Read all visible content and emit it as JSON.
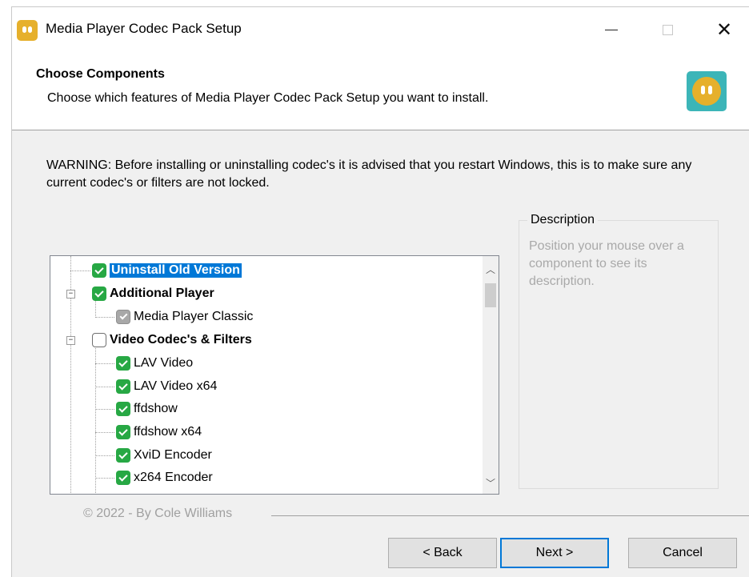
{
  "window": {
    "title": "Media Player Codec Pack Setup"
  },
  "header": {
    "title": "Choose Components",
    "subtitle": "Choose which features of Media Player Codec Pack Setup you want to install."
  },
  "warning": "WARNING: Before installing or uninstalling codec's it is advised that you restart Windows, this is to make sure any current codec's or filters are not locked.",
  "description": {
    "legend": "Description",
    "text": "Position your mouse over a component to see its description."
  },
  "tree": {
    "items": [
      {
        "label": "Uninstall Old Version",
        "state": "checked",
        "bold": true,
        "selected": true
      },
      {
        "label": "Additional Player",
        "state": "checked",
        "bold": true
      },
      {
        "label": "Media Player Classic",
        "state": "partial"
      },
      {
        "label": "Video Codec's & Filters",
        "state": "empty",
        "bold": true
      },
      {
        "label": "LAV Video",
        "state": "checked"
      },
      {
        "label": "LAV Video x64",
        "state": "checked"
      },
      {
        "label": "ffdshow",
        "state": "checked"
      },
      {
        "label": "ffdshow x64",
        "state": "checked"
      },
      {
        "label": "XviD Encoder",
        "state": "checked"
      },
      {
        "label": "x264 Encoder",
        "state": "checked"
      }
    ],
    "expanders": [
      "⊟",
      "⊟"
    ]
  },
  "footer": {
    "copyright": "© 2022 - By Cole Williams"
  },
  "buttons": {
    "back": "< Back",
    "next": "Next >",
    "cancel": "Cancel"
  },
  "icons": {
    "app": "app-logo-icon",
    "minimize": "minimize-icon",
    "maximize": "maximize-icon",
    "close": "close-icon",
    "scroll_up": "chevron-up-icon",
    "scroll_down": "chevron-down-icon"
  },
  "colors": {
    "accent": "#0078d7",
    "checkbox_checked": "#27a844",
    "logo_bg": "#3cb5b8",
    "logo_face": "#e6b02c"
  }
}
